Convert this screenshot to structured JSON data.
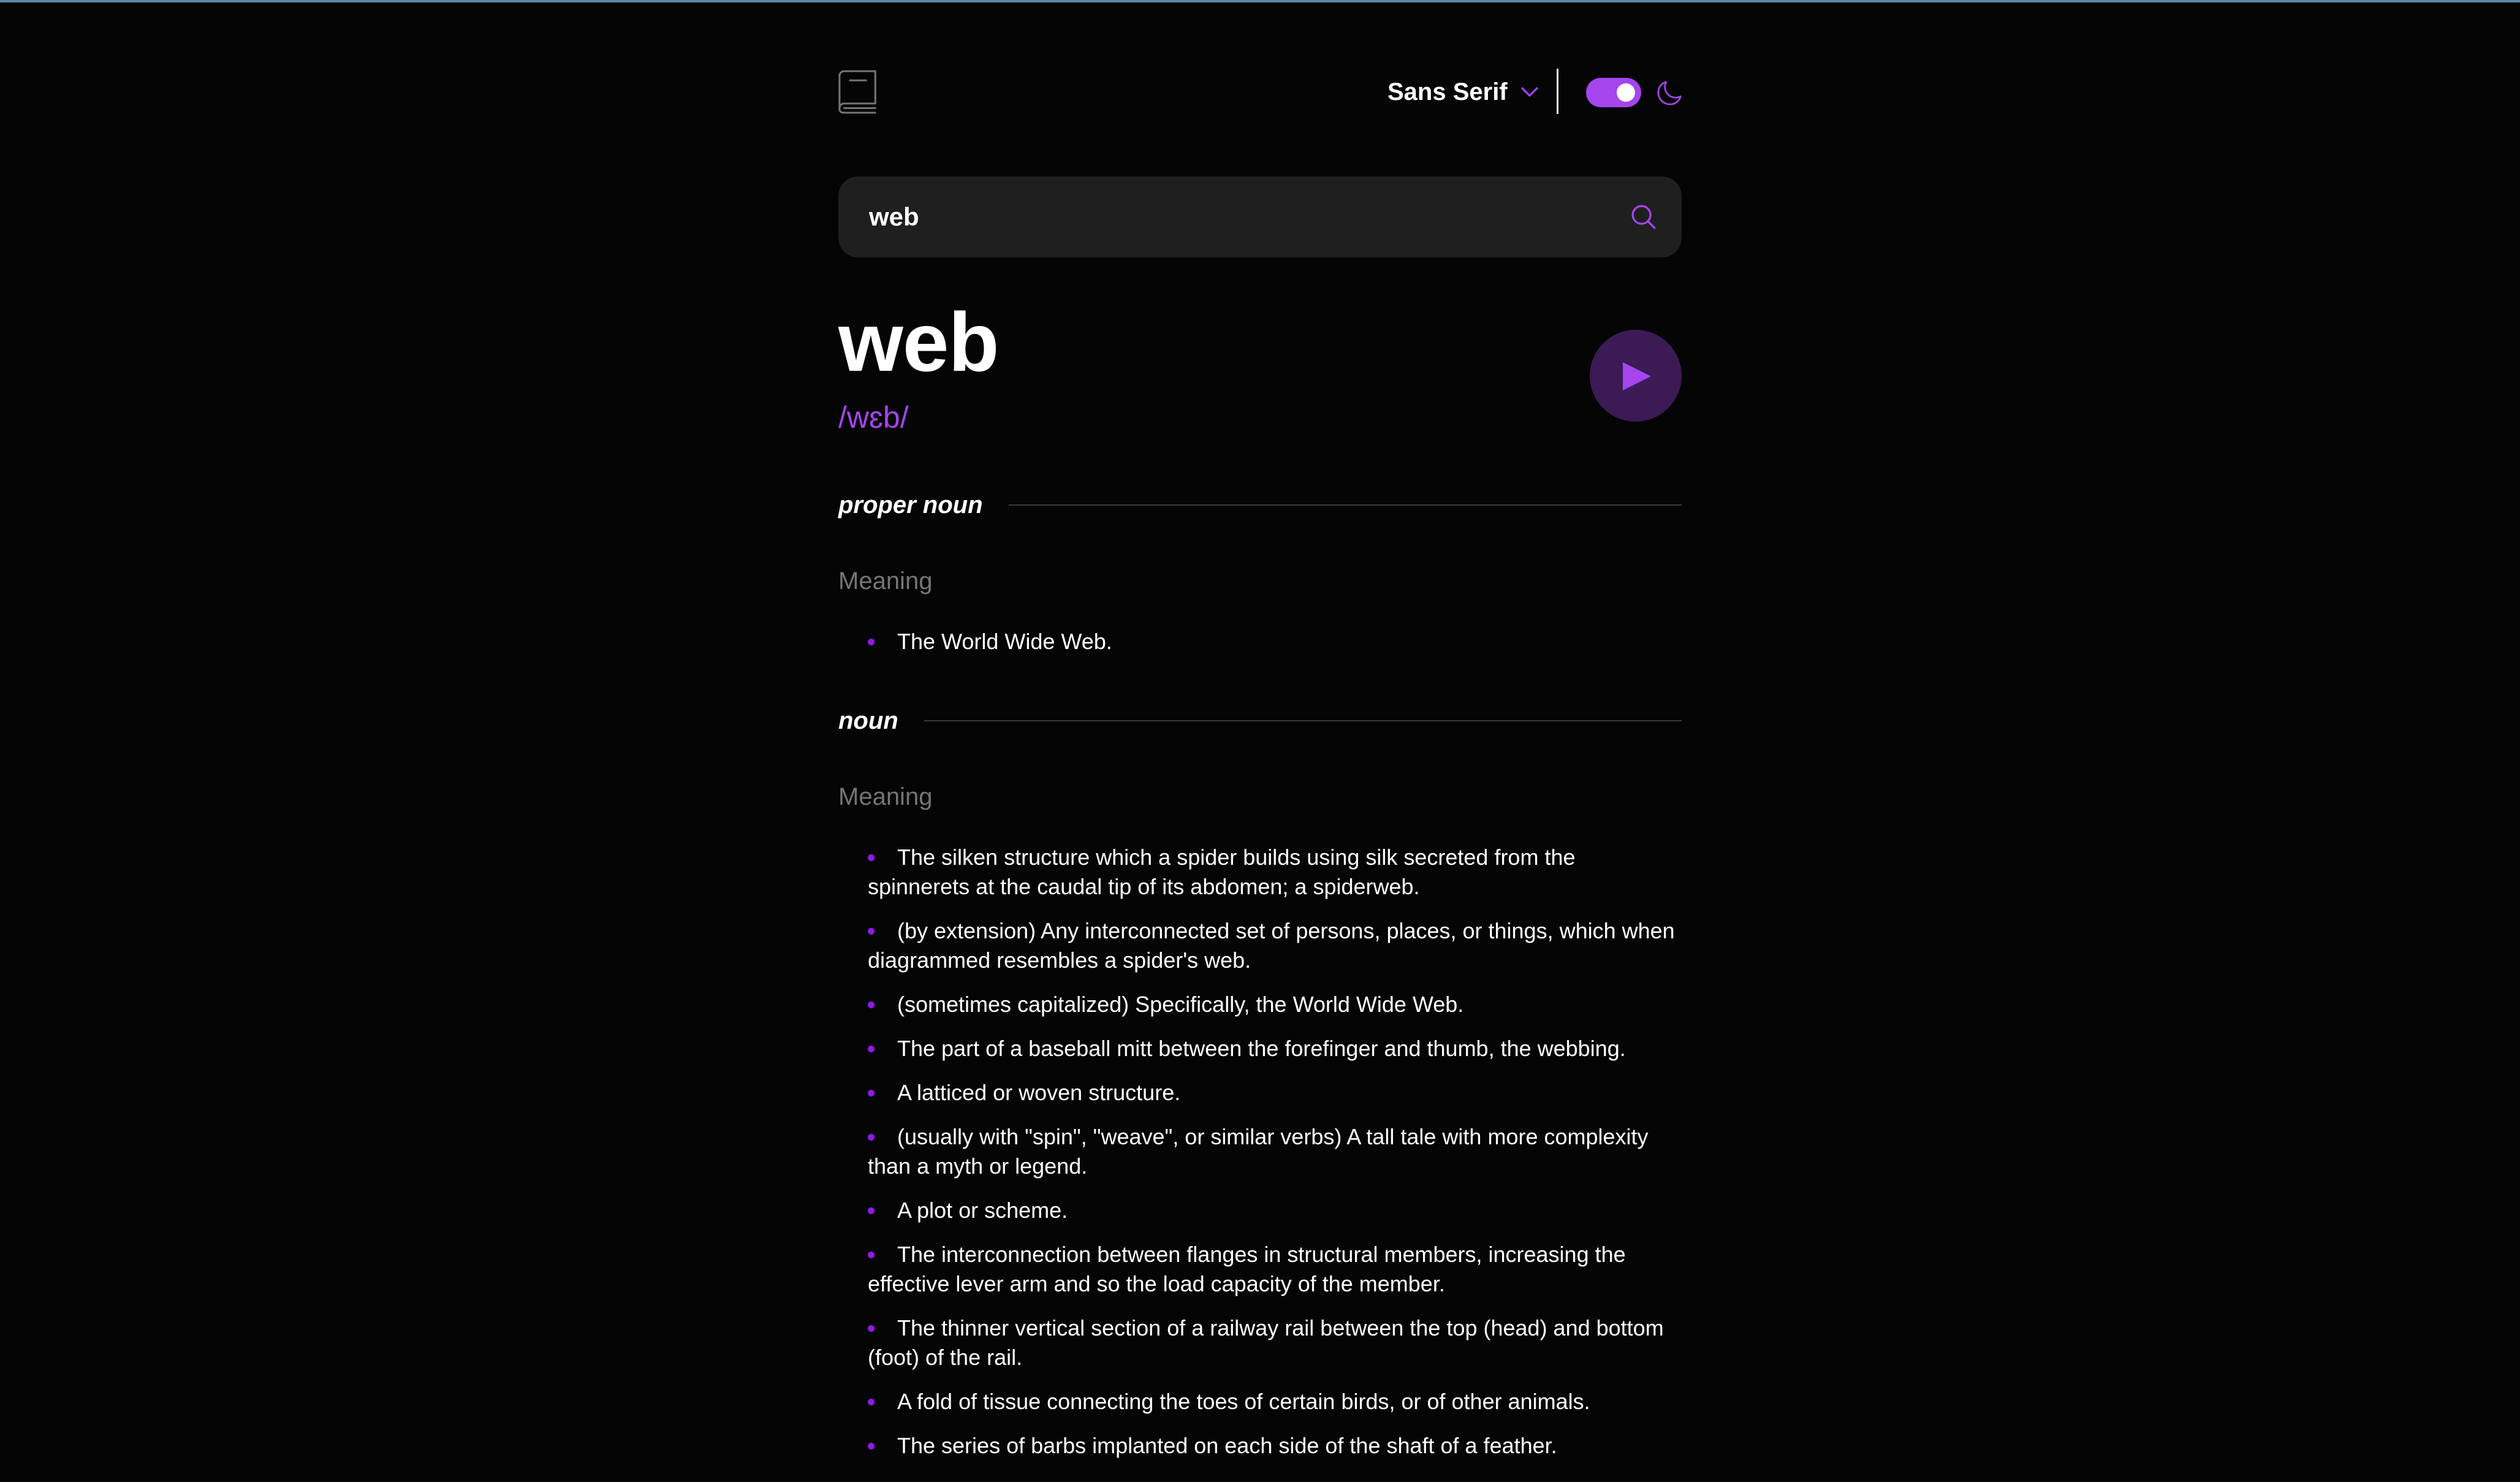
{
  "header": {
    "font_label": "Sans Serif",
    "accent": "#a445ed",
    "icons": [
      "book-icon",
      "chevron-down-icon",
      "moon-icon"
    ]
  },
  "search": {
    "value": "web",
    "icon": "search-icon"
  },
  "entry": {
    "word": "web",
    "phonetic": "/wɛb/",
    "play_icon": "play-icon"
  },
  "sections": [
    {
      "part_of_speech": "proper noun",
      "meaning_label": "Meaning",
      "definitions": [
        "The World Wide Web."
      ]
    },
    {
      "part_of_speech": "noun",
      "meaning_label": "Meaning",
      "definitions": [
        "The silken structure which a spider builds using silk secreted from the spinnerets at the caudal tip of its abdomen; a spiderweb.",
        "(by extension) Any interconnected set of persons, places, or things, which when diagrammed resembles a spider's web.",
        "(sometimes capitalized) Specifically, the World Wide Web.",
        "The part of a baseball mitt between the forefinger and thumb, the webbing.",
        "A latticed or woven structure.",
        "(usually with \"spin\", \"weave\", or similar verbs) A tall tale with more complexity than a myth or legend.",
        "A plot or scheme.",
        "The interconnection between flanges in structural members, increasing the effective lever arm and so the load capacity of the member.",
        "The thinner vertical section of a railway rail between the top (head) and bottom (foot) of the rail.",
        "A fold of tissue connecting the toes of certain birds, or of other animals.",
        "The series of barbs implanted on each side of the shaft of a feather."
      ]
    }
  ]
}
